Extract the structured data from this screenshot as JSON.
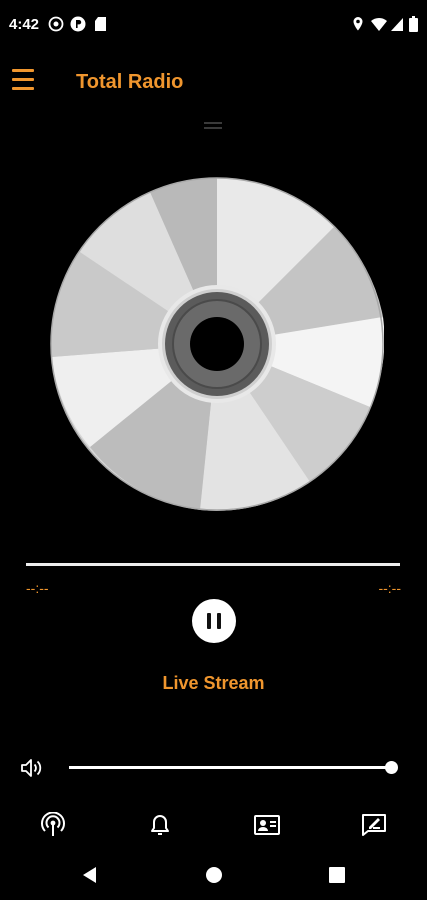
{
  "status_bar": {
    "time": "4:42",
    "icons_left": [
      "play-circle-icon",
      "p-circle-icon",
      "sd-card-icon"
    ],
    "icons_right": [
      "location-icon",
      "wifi-icon",
      "signal-icon",
      "battery-icon"
    ]
  },
  "app_bar": {
    "title": "Total Radio",
    "menu_icon": "menu-icon"
  },
  "player": {
    "elapsed": "--:--",
    "remaining": "--:--",
    "progress": 1.0,
    "state": "playing",
    "stream_title": "Live Stream"
  },
  "volume": {
    "icon": "speaker-icon",
    "level": 1.0
  },
  "bottom_nav": [
    {
      "name": "radio-antenna-icon"
    },
    {
      "name": "bell-icon"
    },
    {
      "name": "contact-card-icon"
    },
    {
      "name": "message-edit-icon"
    }
  ],
  "system_nav": [
    "back-button",
    "home-button",
    "recents-button"
  ],
  "colors": {
    "accent": "#f0962e",
    "background": "#000000",
    "foreground": "#ffffff"
  }
}
